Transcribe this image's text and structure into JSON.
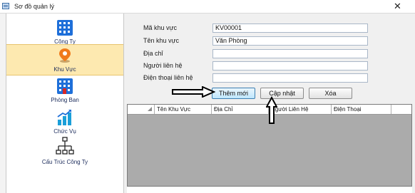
{
  "window": {
    "title": "Sơ đồ quản lý",
    "close_glyph": "✕"
  },
  "sidebar": {
    "items": [
      {
        "label": "Công Ty",
        "icon": "building-icon",
        "active": false
      },
      {
        "label": "Khu Vực",
        "icon": "map-pin-icon",
        "active": true
      },
      {
        "label": "Phòng Ban",
        "icon": "department-building-icon",
        "active": false
      },
      {
        "label": "Chức Vụ",
        "icon": "bar-chart-icon",
        "active": false
      },
      {
        "label": "Cấu Trúc Công Ty",
        "icon": "org-chart-icon",
        "active": false
      }
    ]
  },
  "form": {
    "fields": [
      {
        "label": "Mã khu vực",
        "value": "KV00001"
      },
      {
        "label": "Tên khu vực",
        "value": "Văn Phòng"
      },
      {
        "label": "Địa chỉ",
        "value": ""
      },
      {
        "label": "Người liên hệ",
        "value": ""
      },
      {
        "label": "Điện thoại liên hệ",
        "value": ""
      }
    ],
    "buttons": {
      "add": "Thêm mới",
      "update": "Cập nhật",
      "delete": "Xóa"
    }
  },
  "grid": {
    "columns": [
      "Tên Khu Vực",
      "Địa Chỉ",
      "Người Liên Hệ",
      "Điện Thoại"
    ],
    "rows": []
  },
  "colors": {
    "active_item_bg": "#fde9b0",
    "icon_blue": "#1e6fd9",
    "pin_orange": "#f07a1a",
    "grid_bg": "#ababab"
  }
}
